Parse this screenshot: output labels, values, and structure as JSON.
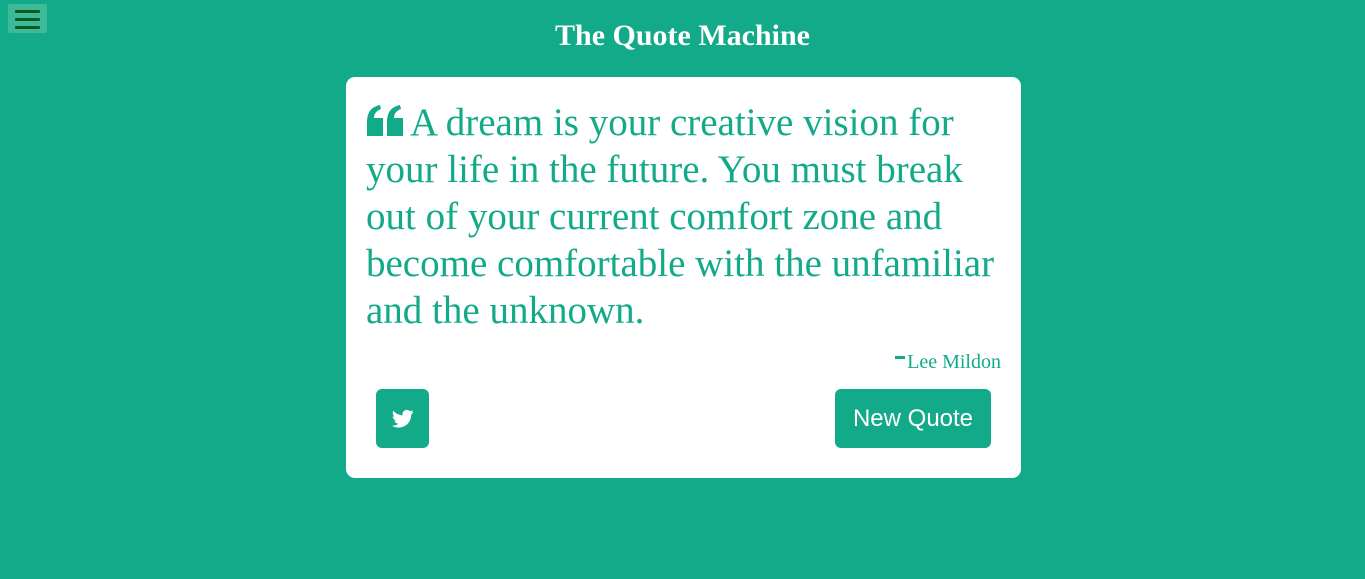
{
  "header": {
    "title": "The Quote Machine",
    "menu_icon": "hamburger-menu-icon"
  },
  "quote": {
    "icon": "quote-left-icon",
    "text": "A dream is your creative vision for your life in the future. You must break out of your current comfort zone and become comfortable with the unfamiliar and the unknown.",
    "author": "Lee Mildon"
  },
  "actions": {
    "tweet_icon": "twitter-icon",
    "new_quote_label": "New Quote"
  },
  "colors": {
    "accent": "#12aa88",
    "card_background": "#ffffff",
    "menu_bars": "#0d5a22"
  }
}
